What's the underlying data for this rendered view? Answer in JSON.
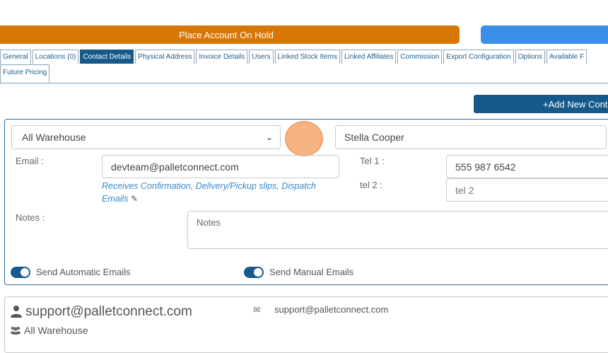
{
  "actions": {
    "hold_label": "Place Account On Hold",
    "blue_label": "",
    "add_contact_label": "+Add New Contact"
  },
  "tabs": [
    {
      "label": "General",
      "active": false
    },
    {
      "label": "Locations (0)",
      "active": false
    },
    {
      "label": "Contact Details",
      "active": true
    },
    {
      "label": "Physical Address",
      "active": false
    },
    {
      "label": "Invoice Details",
      "active": false
    },
    {
      "label": "Users",
      "active": false
    },
    {
      "label": "Linked Stock Items",
      "active": false
    },
    {
      "label": "Linked Affiliates",
      "active": false
    },
    {
      "label": "Commission",
      "active": false
    },
    {
      "label": "Export Configuration",
      "active": false
    },
    {
      "label": "Options",
      "active": false
    },
    {
      "label": "Available F",
      "active": false
    },
    {
      "label": "Future Pricing",
      "active": false
    }
  ],
  "form": {
    "warehouse_select": "All Warehouse",
    "contact_name": "Stella Cooper",
    "email_label": "Email :",
    "email_value": "devteam@palletconnect.com",
    "email_hint": "Receives Confirmation, Delivery/Pickup slips, Dispatch Emails",
    "tel1_label": "Tel 1 :",
    "tel1_value": "555 987 6542",
    "tel2_label": "tel 2 :",
    "tel2_placeholder": "tel 2",
    "notes_label": "Notes :",
    "notes_placeholder": "Notes",
    "auto_emails_label": "Send Automatic Emails",
    "manual_emails_label": "Send Manual Emails",
    "auto_emails_on": true,
    "manual_emails_on": true
  },
  "contact_card": {
    "title": "support@palletconnect.com",
    "email": "support@palletconnect.com",
    "group": "All Warehouse"
  },
  "colors": {
    "hold": "#d97706",
    "primary": "#155a8a",
    "accent_blue": "#3b8fe8",
    "hint": "#3a89c8"
  }
}
